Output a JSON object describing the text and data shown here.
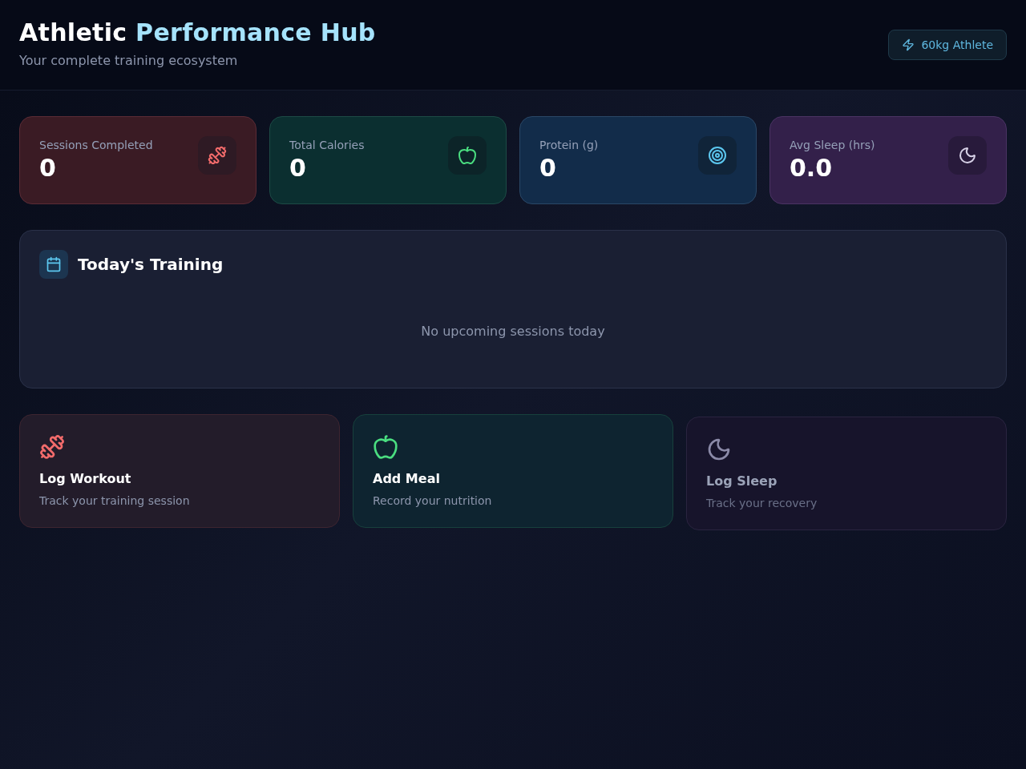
{
  "header": {
    "title": [
      {
        "text": "Athletic ",
        "accent": false
      },
      {
        "text": "Performance Hub",
        "accent": true
      }
    ],
    "subtitle": "Your complete training ecosystem",
    "badge": {
      "label": "60kg Athlete"
    }
  },
  "stats": [
    {
      "label": "Sessions Completed",
      "value": "0",
      "kind": "workout"
    },
    {
      "label": "Total Calories",
      "value": "0",
      "kind": "meal"
    },
    {
      "label": "Protein (g)",
      "value": "0",
      "kind": "protein"
    },
    {
      "label": "Avg Sleep (hrs)",
      "value": "0.0",
      "kind": "sleep"
    }
  ],
  "today": {
    "title": "Today's Training",
    "empty_message": "No upcoming sessions today"
  },
  "actions": [
    {
      "title": "Log Workout",
      "description": "Track your training session",
      "kind": "workout",
      "disabled": false
    },
    {
      "title": "Add Meal",
      "description": "Record your nutrition",
      "kind": "meal",
      "disabled": false
    },
    {
      "title": "Log Sleep",
      "description": "Track your recovery",
      "kind": "sleep",
      "disabled": true
    }
  ]
}
